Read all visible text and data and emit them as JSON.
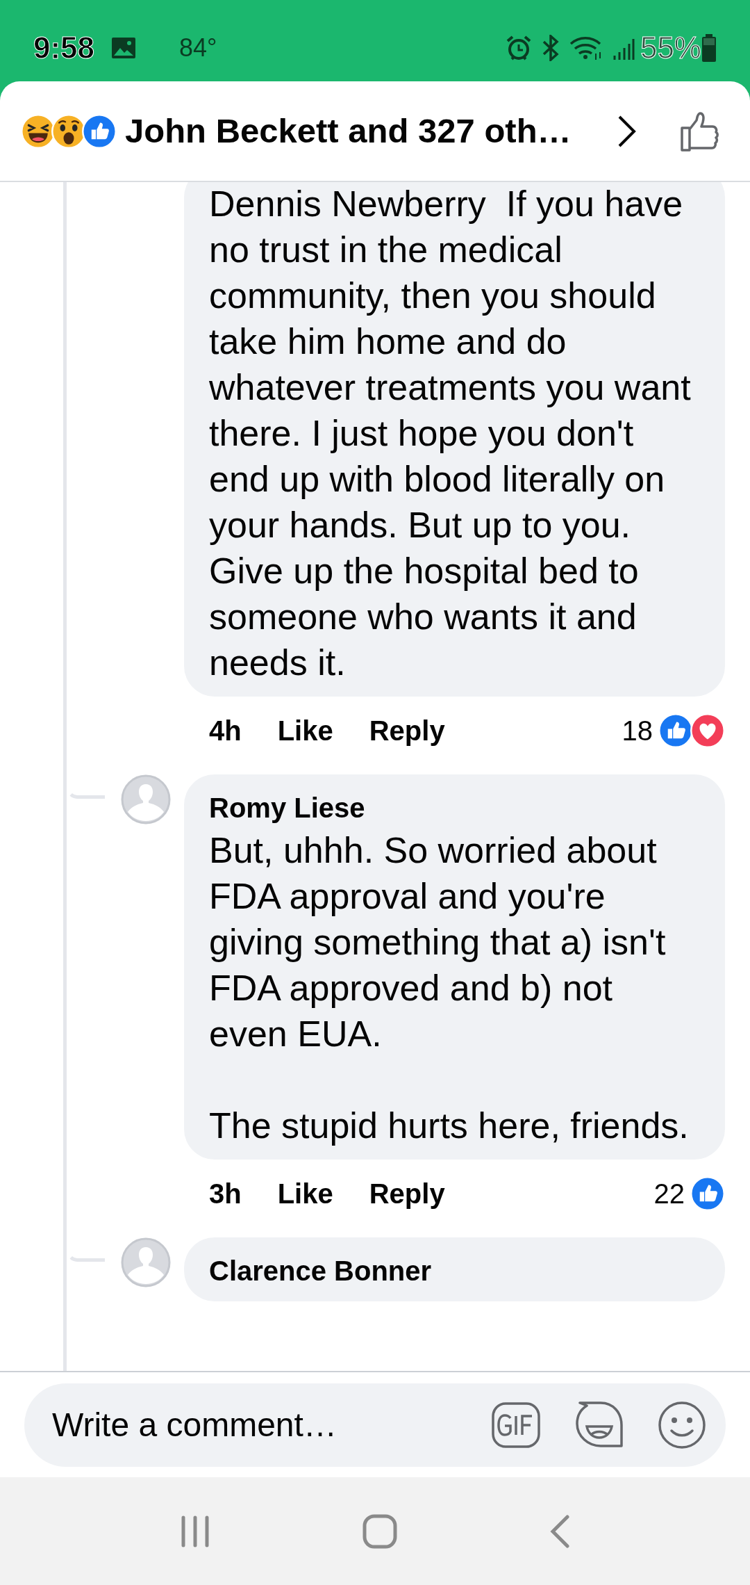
{
  "status_bar": {
    "time": "9:58",
    "temperature": "84°",
    "battery": "55%"
  },
  "header": {
    "reactions": [
      {
        "kind": "haha"
      },
      {
        "kind": "wow"
      },
      {
        "kind": "like"
      }
    ],
    "title": "John Beckett and 327 oth…"
  },
  "comments": [
    {
      "text": "Dennis Newberry  If you have no trust in the medical community, then you should take him home and do whatever treatments you want there. I just hope you don't end up with blood literally on your hands. But up to you.\nGive up the hospital bed to someone who wants it and needs it.",
      "time": "4h",
      "like": "Like",
      "reply": "Reply",
      "reaction_count": "18",
      "reactions": [
        {
          "kind": "like"
        },
        {
          "kind": "love"
        }
      ]
    },
    {
      "author": "Romy Liese",
      "text": "But, uhhh. So worried about FDA approval and you're giving something that a) isn't FDA approved and b) not even EUA.\n\nThe stupid hurts here, friends.",
      "time": "3h",
      "like": "Like",
      "reply": "Reply",
      "reaction_count": "22",
      "reactions": [
        {
          "kind": "like"
        }
      ]
    },
    {
      "author": "Clarence Bonner"
    }
  ],
  "composer": {
    "placeholder": "Write a comment…"
  }
}
